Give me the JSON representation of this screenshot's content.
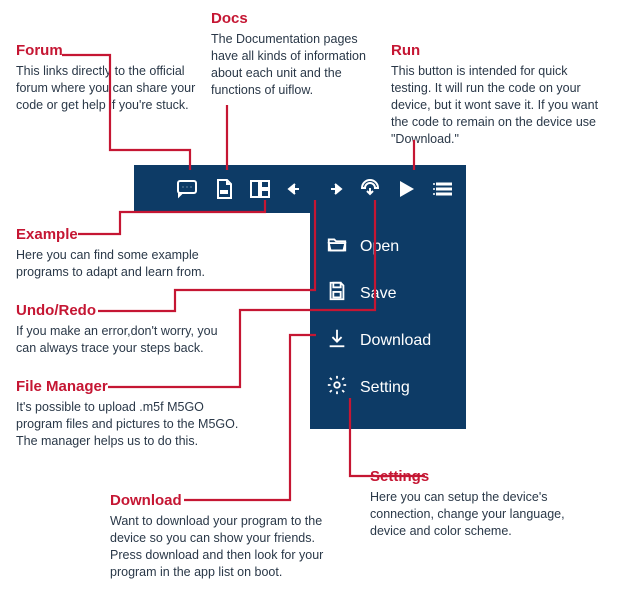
{
  "callouts": {
    "forum": {
      "title": "Forum",
      "body": "This links directly to the official forum where you can share your code or get help if you're stuck."
    },
    "docs": {
      "title": "Docs",
      "body": "The Documentation pages have all kinds of information about each unit and the functions of uiflow."
    },
    "run": {
      "title": "Run",
      "body": "This button is intended for quick testing. It will run the code on your device, but it wont save it. If you want the code to remain on the device use \"Download.\""
    },
    "example": {
      "title": "Example",
      "body": "Here you can find some example programs to adapt and learn from."
    },
    "undoredo": {
      "title": "Undo/Redo",
      "body": "If you make an error,don't worry, you can always trace your steps back."
    },
    "filemanager": {
      "title": "File Manager",
      "body": "It's possible to upload .m5f M5GO program files and pictures to the M5GO. The manager helps us to do this."
    },
    "download": {
      "title": "Download",
      "body": "Want to download your program to the device so you can show your friends. Press download and then look for your program in the app list on boot."
    },
    "settings": {
      "title": "Settings",
      "body": "Here you can setup the device's connection, change your language, device and color scheme."
    }
  },
  "menu": {
    "open": "Open",
    "save": "Save",
    "download": "Download",
    "setting": "Setting"
  }
}
